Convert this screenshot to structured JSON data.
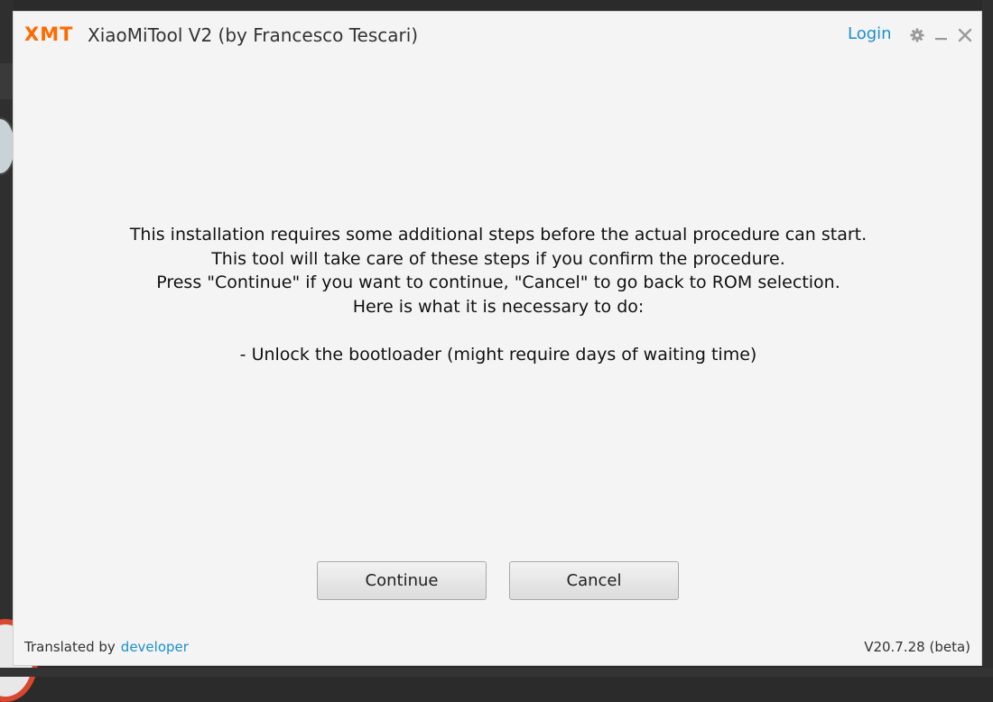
{
  "window": {
    "logo": "XMT",
    "title": "XiaoMiTool V2 (by Francesco Tescari)",
    "login_label": "Login",
    "icons": {
      "settings": "gear-icon",
      "minimize": "minimize-icon",
      "close": "close-icon"
    }
  },
  "message": {
    "lines": [
      "This installation requires some additional steps before the actual procedure can start.",
      "This tool will take care of these steps if you confirm the procedure.",
      "Press \"Continue\" if you want to continue, \"Cancel\" to go back to ROM selection.",
      "Here is what it is necessary to do:",
      "",
      "- Unlock the bootloader (might require days of waiting time)"
    ]
  },
  "buttons": {
    "continue_label": "Continue",
    "cancel_label": "Cancel"
  },
  "footer": {
    "translated_by_label": "Translated by",
    "translator": "developer",
    "version": "V20.7.28 (beta)"
  },
  "colors": {
    "brand": "#ff6a00",
    "link": "#1e8fcf",
    "window_bg": "#f4f4f4"
  }
}
